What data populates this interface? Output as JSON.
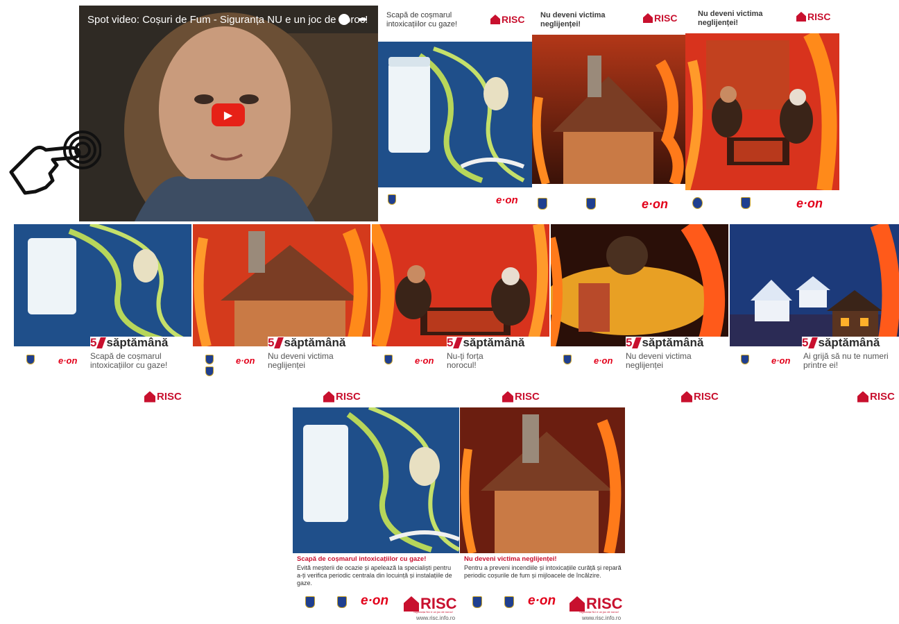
{
  "video": {
    "title": "Spot video: Coșuri de Fum - Siguranța NU e un joc de noroc!",
    "play_label": "▶"
  },
  "brand": {
    "risc": "RISC",
    "eon": "e·on",
    "risc_slogan": "Siguranța NU e un joc de noroc!",
    "risc_url": "www.risc.info.ro"
  },
  "top_posters": [
    {
      "headline": "Scapă de coșmarul intoxicațiilor cu gaze!"
    },
    {
      "headline": "Nu deveni victima neglijenței!"
    },
    {
      "headline": "Nu deveni victima neglijenței!"
    }
  ],
  "wide_posters": [
    {
      "band": "săptămână",
      "band_num": "5",
      "headline": "Scapă de coșmarul intoxicațiilor cu gaze!"
    },
    {
      "band": "săptămână",
      "band_num": "5",
      "headline": "Nu deveni victima neglijenței"
    },
    {
      "band": "săptămână",
      "band_num": "5",
      "headline": "Nu-ți forța norocul!"
    },
    {
      "band": "săptămână",
      "band_num": "5",
      "headline": "Nu deveni victima neglijenței"
    },
    {
      "band": "săptămână",
      "band_num": "5",
      "headline": "Ai grijă să nu te numeri printre ei!"
    }
  ],
  "bottom_posters": [
    {
      "headline": "Scapă de coșmarul intoxicațiilor cu gaze!",
      "body": "Evită meșterii de ocazie și apelează la specialiști pentru a-ți verifica periodic centrala din locuință și instalațiile de gaze."
    },
    {
      "headline": "Nu deveni victima neglijenței!",
      "body": "Pentru a preveni incendiile și intoxicațiile curăță și repară periodic coșurile de fum și mijloacele de încălzire."
    }
  ],
  "colors": {
    "red": "#c8102e",
    "fire": "#e53a1f",
    "navy": "#1c3a7a",
    "flame_green": "#b7d65a"
  }
}
